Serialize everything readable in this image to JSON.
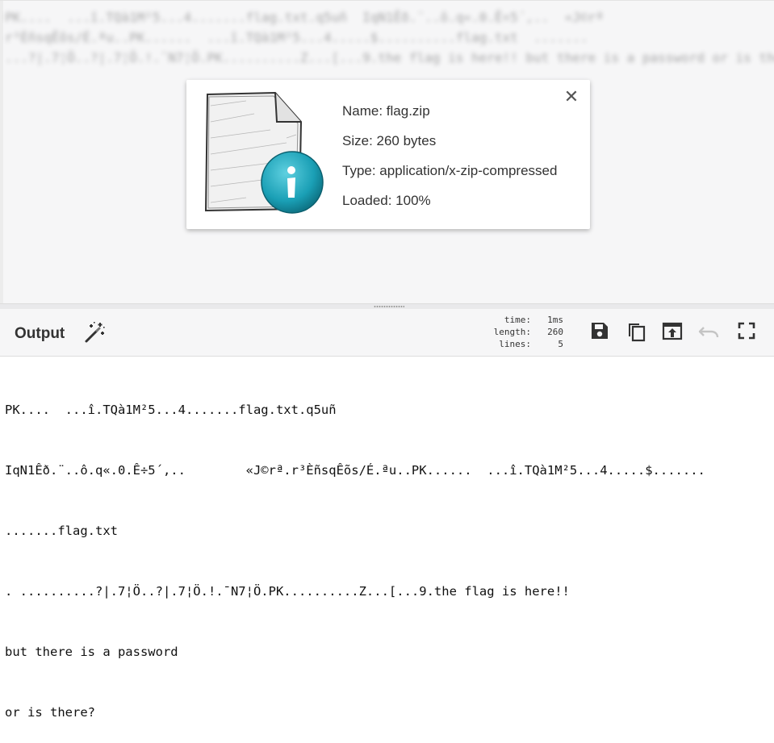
{
  "input": {
    "blurred_lines": [
      "PK....  ...î.TQà1M²5...4.......flag.txt.q5uñ  IqN1Êð.¨..ô.q«.0.Ê÷5´,..  «J©rª",
      "r³ÈñsqÊõs/É.ªu..PK......  ...î.TQà1M²5...4.....$..........flag.txt  .......",
      "...?|.7¦Ö..?|.7¦Ö.!.¯N7¦Ö.PK..........Z...[...9.the flag is here!! but there is a password or is there?"
    ]
  },
  "file_info": {
    "name_line": "Name: flag.zip",
    "size_line": "Size: 260 bytes",
    "type_line": "Type: application/x-zip-compressed",
    "loaded_line": "Loaded: 100%",
    "close_symbol": "✕"
  },
  "output": {
    "title": "Output",
    "stats": [
      {
        "label": "time:",
        "value": "1ms"
      },
      {
        "label": "length:",
        "value": "260"
      },
      {
        "label": "lines:",
        "value": "5"
      }
    ],
    "lines": [
      "PK....  ...î.TQà1M²5...4.......flag.txt.q5uñ",
      "IqN1Êð.¨..ô.q«.0.Ê÷5´,..        «J©rª.r³ÈñsqÊõs/É.ªu..PK......  ...î.TQà1M²5...4.....$.......",
      ".......flag.txt",
      ". ..........?|.7¦Ö..?|.7¦Ö.!.¯N7¦Ö.PK..........Z...[...9.the flag is here!!",
      "but there is a password",
      "or is there?"
    ]
  },
  "icons": {
    "magic": "magic-wand-icon",
    "save": "save-icon",
    "copy": "copy-icon",
    "replace": "move-output-to-input-icon",
    "undo": "undo-icon",
    "maximise": "fullscreen-icon"
  },
  "colors": {
    "accent_teal": "#1a9fb5",
    "undo_disabled": "#c4c4c4"
  }
}
